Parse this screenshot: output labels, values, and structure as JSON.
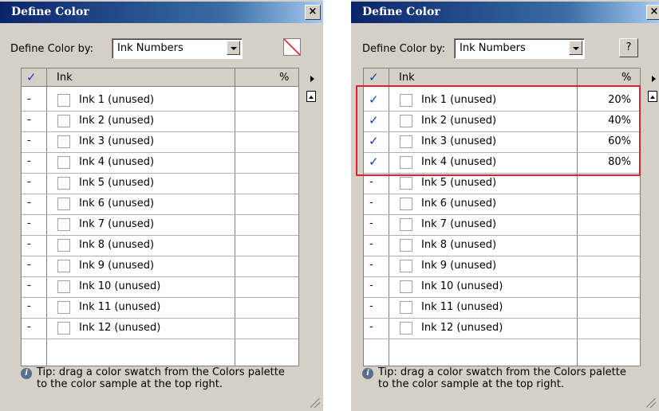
{
  "left": {
    "title": "Define Color",
    "close_label": "×",
    "define_by_label": "Define Color by:",
    "define_by_value": "Ink Numbers",
    "header": {
      "check": "✓",
      "ink": "Ink",
      "pct": "%"
    },
    "rows": [
      {
        "mark": "-",
        "name": "Ink 1 (unused)",
        "pct": ""
      },
      {
        "mark": "-",
        "name": "Ink 2 (unused)",
        "pct": ""
      },
      {
        "mark": "-",
        "name": "Ink 3 (unused)",
        "pct": ""
      },
      {
        "mark": "-",
        "name": "Ink 4 (unused)",
        "pct": ""
      },
      {
        "mark": "-",
        "name": "Ink 5 (unused)",
        "pct": ""
      },
      {
        "mark": "-",
        "name": "Ink 6 (unused)",
        "pct": ""
      },
      {
        "mark": "-",
        "name": "Ink 7 (unused)",
        "pct": ""
      },
      {
        "mark": "-",
        "name": "Ink 8 (unused)",
        "pct": ""
      },
      {
        "mark": "-",
        "name": "Ink 9 (unused)",
        "pct": ""
      },
      {
        "mark": "-",
        "name": "Ink 10 (unused)",
        "pct": ""
      },
      {
        "mark": "-",
        "name": "Ink 11 (unused)",
        "pct": ""
      },
      {
        "mark": "-",
        "name": "Ink 12 (unused)",
        "pct": ""
      }
    ],
    "tip_icon": "i",
    "tip": "Tip: drag a color swatch  from the Colors palette\nto the color sample at the top right."
  },
  "right": {
    "title": "Define Color",
    "close_label": "×",
    "define_by_label": "Define Color by:",
    "define_by_value": "Ink Numbers",
    "help_label": "?",
    "header": {
      "check": "✓",
      "ink": "Ink",
      "pct": "%"
    },
    "rows": [
      {
        "mark": "✓",
        "name": "Ink 1 (unused)",
        "pct": "20%"
      },
      {
        "mark": "✓",
        "name": "Ink 2 (unused)",
        "pct": "40%"
      },
      {
        "mark": "✓",
        "name": "Ink 3 (unused)",
        "pct": "60%"
      },
      {
        "mark": "✓",
        "name": "Ink 4 (unused)",
        "pct": "80%"
      },
      {
        "mark": "-",
        "name": "Ink 5 (unused)",
        "pct": ""
      },
      {
        "mark": "-",
        "name": "Ink 6 (unused)",
        "pct": ""
      },
      {
        "mark": "-",
        "name": "Ink 7 (unused)",
        "pct": ""
      },
      {
        "mark": "-",
        "name": "Ink 8 (unused)",
        "pct": ""
      },
      {
        "mark": "-",
        "name": "Ink 9 (unused)",
        "pct": ""
      },
      {
        "mark": "-",
        "name": "Ink 10 (unused)",
        "pct": ""
      },
      {
        "mark": "-",
        "name": "Ink 11 (unused)",
        "pct": ""
      },
      {
        "mark": "-",
        "name": "Ink 12 (unused)",
        "pct": ""
      }
    ],
    "tip_icon": "i",
    "tip": "Tip: drag a color swatch  from the Colors palette\nto the color sample at the top right."
  },
  "colors": {
    "dialog_bg": "#d4d0c8",
    "title_bar": "#0a246a",
    "check_mark": "#1a3ab0",
    "highlight_border": "#e02030",
    "swatch_slash": "#e03030"
  },
  "icons": {
    "close": "close-icon",
    "dropdown": "chevron-down-icon",
    "swatch": "no-color-swatch-icon",
    "help": "help-icon",
    "menu": "panel-menu-triangle-icon",
    "pin": "pin-icon",
    "info": "info-icon",
    "resize": "resize-grip-icon"
  }
}
